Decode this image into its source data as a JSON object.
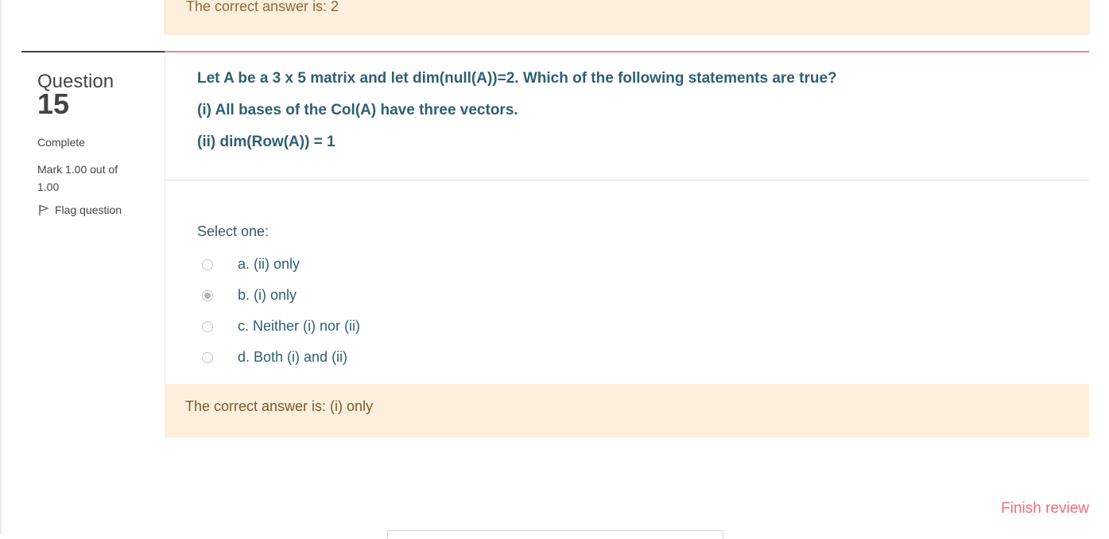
{
  "previous_feedback": {
    "text": "The correct answer is: 2"
  },
  "question": {
    "label": "Question",
    "number": "15",
    "state": "Complete",
    "mark": "Mark 1.00 out of 1.00",
    "flag_label": "Flag question",
    "text_lines": [
      "Let A be a 3 x 5 matrix and let dim(null(A))=2. Which of the following statements are true?",
      "(i) All bases of the Col(A) have three vectors.",
      "(ii) dim(Row(A)) = 1"
    ],
    "prompt": "Select one:",
    "options": [
      {
        "label": "a. (ii) only",
        "selected": false
      },
      {
        "label": "b. (i) only",
        "selected": true
      },
      {
        "label": "c. Neither (i) nor (ii)",
        "selected": false
      },
      {
        "label": "d. Both (i) and (ii)",
        "selected": false
      }
    ],
    "feedback": "The correct answer is: (i) only"
  },
  "footer": {
    "finish_review": "Finish review"
  },
  "colors": {
    "accent": "#f26b7a",
    "feedback_bg": "#fcefdc",
    "question_text": "#2f5f72"
  },
  "icons": {
    "flag": "flag-icon"
  }
}
